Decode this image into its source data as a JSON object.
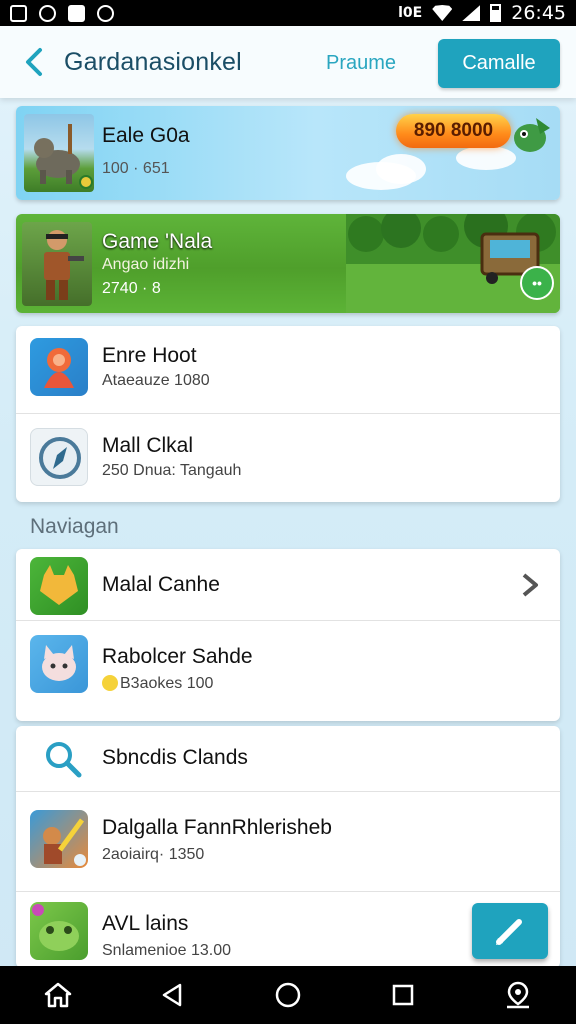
{
  "status_bar": {
    "time": "26:45",
    "vibrate": "l0E"
  },
  "header": {
    "title": "Gardanasionkel",
    "link": "Praume",
    "button": "Camalle"
  },
  "banners": [
    {
      "title": "Eale G0a",
      "subtitle": "100 · 651",
      "badge": "890 8000"
    },
    {
      "title": "Game 'Nala",
      "subtitle": "Angao idizhi",
      "meta": "2740 · 8"
    }
  ],
  "card1": {
    "rows": [
      {
        "title": "Enre Hoot",
        "subtitle": "Ataeauze 1080"
      },
      {
        "title": "Mall Clkal",
        "subtitle": "250 Dnua: Tangauh"
      }
    ]
  },
  "section_label": "Naviagan",
  "card2": {
    "rows": [
      {
        "title": "Malal Canhe",
        "subtitle": ""
      },
      {
        "title": "Rabolcer Sahde",
        "subtitle": "B3aokes 100"
      }
    ]
  },
  "card3": {
    "rows": [
      {
        "title": "Sbncdis Clands",
        "subtitle": ""
      },
      {
        "title": "Dalgalla FannRhlerisheb",
        "subtitle": "2aoiairq· 1350"
      },
      {
        "title": "AVL lains",
        "subtitle": "Snlamenioe 13.00"
      }
    ]
  },
  "colors": {
    "accent": "#1fa3be",
    "title": "#1b4e66",
    "link": "#2aa6c0"
  },
  "icons": [
    "back-arrow-icon",
    "search-icon",
    "compass-icon",
    "chevron-right-icon",
    "pencil-icon",
    "home-icon",
    "back-triangle-icon",
    "circle-home-icon",
    "square-recents-icon",
    "location-pin-icon"
  ]
}
